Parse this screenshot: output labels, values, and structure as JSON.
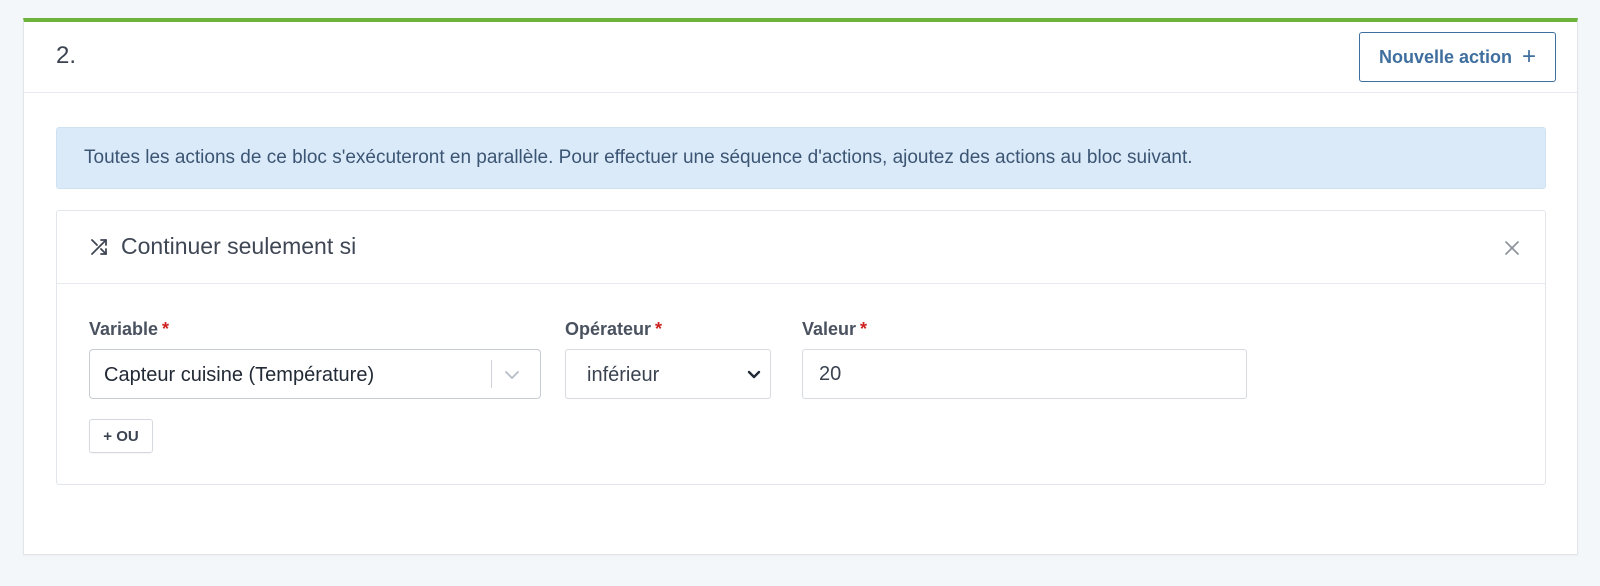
{
  "step": {
    "number": "2.",
    "new_action_label": "Nouvelle action",
    "new_action_icon": "plus-icon"
  },
  "info": {
    "text": "Toutes les actions de ce bloc s'exécuteront en parallèle. Pour effectuer une séquence d'actions, ajoutez des actions au bloc suivant."
  },
  "action": {
    "icon": "shuffle-icon",
    "title": "Continuer seulement si",
    "close_icon": "close-icon"
  },
  "condition": {
    "variable_label": "Variable",
    "variable_value": "Capteur cuisine (Température)",
    "operator_label": "Opérateur",
    "operator_value": "inférieur",
    "value_label": "Valeur",
    "value_value": "20",
    "required_mark": "*",
    "or_button": "+ OU"
  },
  "colors": {
    "accent_green": "#6bb33a",
    "primary_blue": "#3f6f9e",
    "info_bg": "#dbeaf8",
    "required_red": "#cd201f"
  }
}
